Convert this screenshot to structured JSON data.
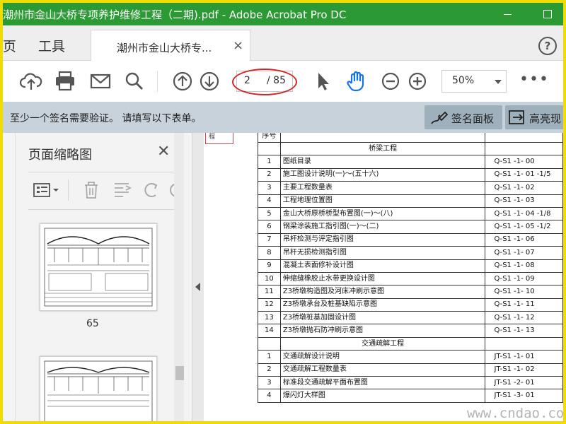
{
  "window": {
    "title": "潮州市金山大桥专项养护维修工程（二期).pdf - Adobe Acrobat Pro DC"
  },
  "tabs": {
    "home": "页",
    "tools": "工具",
    "doc_tab_label": "潮州市金山大桥专...",
    "help": "?"
  },
  "toolbar": {
    "current_page": "2",
    "total_pages": "/ 85",
    "zoom": "50%",
    "more": "•••"
  },
  "notice": {
    "message": "至少一个签名需要验证。  请填写以下表单。",
    "sign_panel": "签名面板",
    "highlight": "高亮现"
  },
  "thumbnail_panel": {
    "title": "页面缩略图",
    "page_label": "65"
  },
  "document": {
    "header_fragment": "序号",
    "corner_text": "程",
    "sections": [
      {
        "title": "桥梁工程",
        "rows": [
          {
            "no": "1",
            "name": "图纸目录",
            "code": "Q-S1 -1- 00"
          },
          {
            "no": "2",
            "name": "施工图设计说明(一)～(五十六)",
            "code": "Q-S1 -1- 01 -1/5"
          },
          {
            "no": "3",
            "name": "主要工程数量表",
            "code": "Q-S1 -1- 02"
          },
          {
            "no": "4",
            "name": "工程地理位置图",
            "code": "Q-S1 -1- 03"
          },
          {
            "no": "5",
            "name": "金山大桥原桥桥型布置图(一)～(八)",
            "code": "Q-S1 -1- 04 -1/8"
          },
          {
            "no": "6",
            "name": "钢梁涂装施工指引图(一)～(二)",
            "code": "Q-S1 -1- 05 -1/2"
          },
          {
            "no": "7",
            "name": "吊杆检测与评定指引图",
            "code": "Q-S1 -1- 06"
          },
          {
            "no": "8",
            "name": "吊杆无损检测指引图",
            "code": "Q-S1 -1- 07"
          },
          {
            "no": "9",
            "name": "混凝土表面修补设计图",
            "code": "Q-S1 -1- 08"
          },
          {
            "no": "10",
            "name": "伸缩缝橡胶止水带更换设计图",
            "code": "Q-S1 -1- 09"
          },
          {
            "no": "11",
            "name": "Z3桥墩构造图及河床冲刷示意图",
            "code": "Q-S1 -1- 10"
          },
          {
            "no": "12",
            "name": "Z3桥墩承台及桩基缺陷示意图",
            "code": "Q-S1 -1- 11"
          },
          {
            "no": "13",
            "name": "Z3桥墩桩基加固设计图",
            "code": "Q-S1 -1- 12"
          },
          {
            "no": "14",
            "name": "Z3桥墩抛石防冲刷示意图",
            "code": "Q-S1 -1- 13"
          }
        ]
      },
      {
        "title": "交通疏解工程",
        "rows": [
          {
            "no": "1",
            "name": "交通疏解设计说明",
            "code": "JT-S1 -1- 01"
          },
          {
            "no": "2",
            "name": "交通疏解工程数量表",
            "code": "JT-S1 -1- 02"
          },
          {
            "no": "3",
            "name": "标准段交通疏解平面布置图",
            "code": "JT-S1 -2- 01"
          },
          {
            "no": "4",
            "name": "爆闪灯大样图",
            "code": "JT-S1 -3- 01"
          }
        ]
      }
    ]
  },
  "watermark": {
    "bottom_right": "www.cndao.com",
    "top_left": "潮州市金山大"
  },
  "colors": {
    "titlebar": "#2b9a34",
    "accent": "#1473e6",
    "annotation": "#d42424",
    "frame": "#f0dc00"
  }
}
